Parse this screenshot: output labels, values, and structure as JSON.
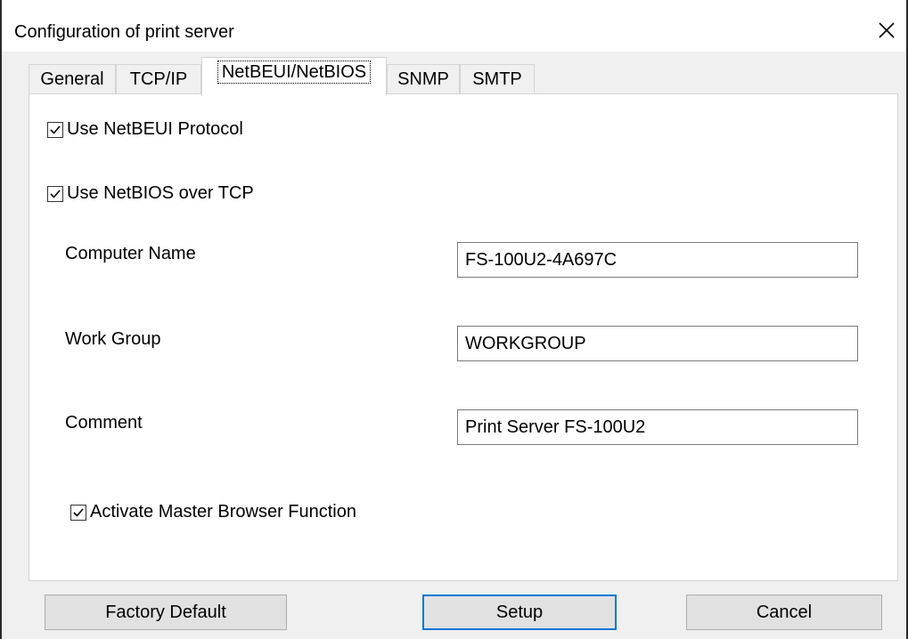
{
  "window": {
    "title": "Configuration of print server"
  },
  "tabs": [
    {
      "label": "General"
    },
    {
      "label": "TCP/IP"
    },
    {
      "label": "NetBEUI/NetBIOS"
    },
    {
      "label": "SNMP"
    },
    {
      "label": "SMTP"
    }
  ],
  "active_tab": "NetBEUI/NetBIOS",
  "options": {
    "use_netbeui": {
      "label": "Use NetBEUI Protocol",
      "checked": true
    },
    "use_netbios_tcp": {
      "label": "Use NetBIOS over TCP",
      "checked": true
    },
    "master_browser": {
      "label": "Activate Master Browser Function",
      "checked": true
    }
  },
  "fields": {
    "computer_name": {
      "label": "Computer Name",
      "value": "FS-100U2-4A697C"
    },
    "work_group": {
      "label": "Work Group",
      "value": "WORKGROUP"
    },
    "comment": {
      "label": "Comment",
      "value": "Print Server FS-100U2"
    }
  },
  "buttons": {
    "factory_default": "Factory Default",
    "setup": "Setup",
    "cancel": "Cancel"
  },
  "icons": {
    "close": "close-icon",
    "checkmark": "checkmark-icon"
  },
  "colors": {
    "focus_border": "#0078d7",
    "panel_bg": "#ffffff",
    "window_bg": "#f0f0f0"
  }
}
